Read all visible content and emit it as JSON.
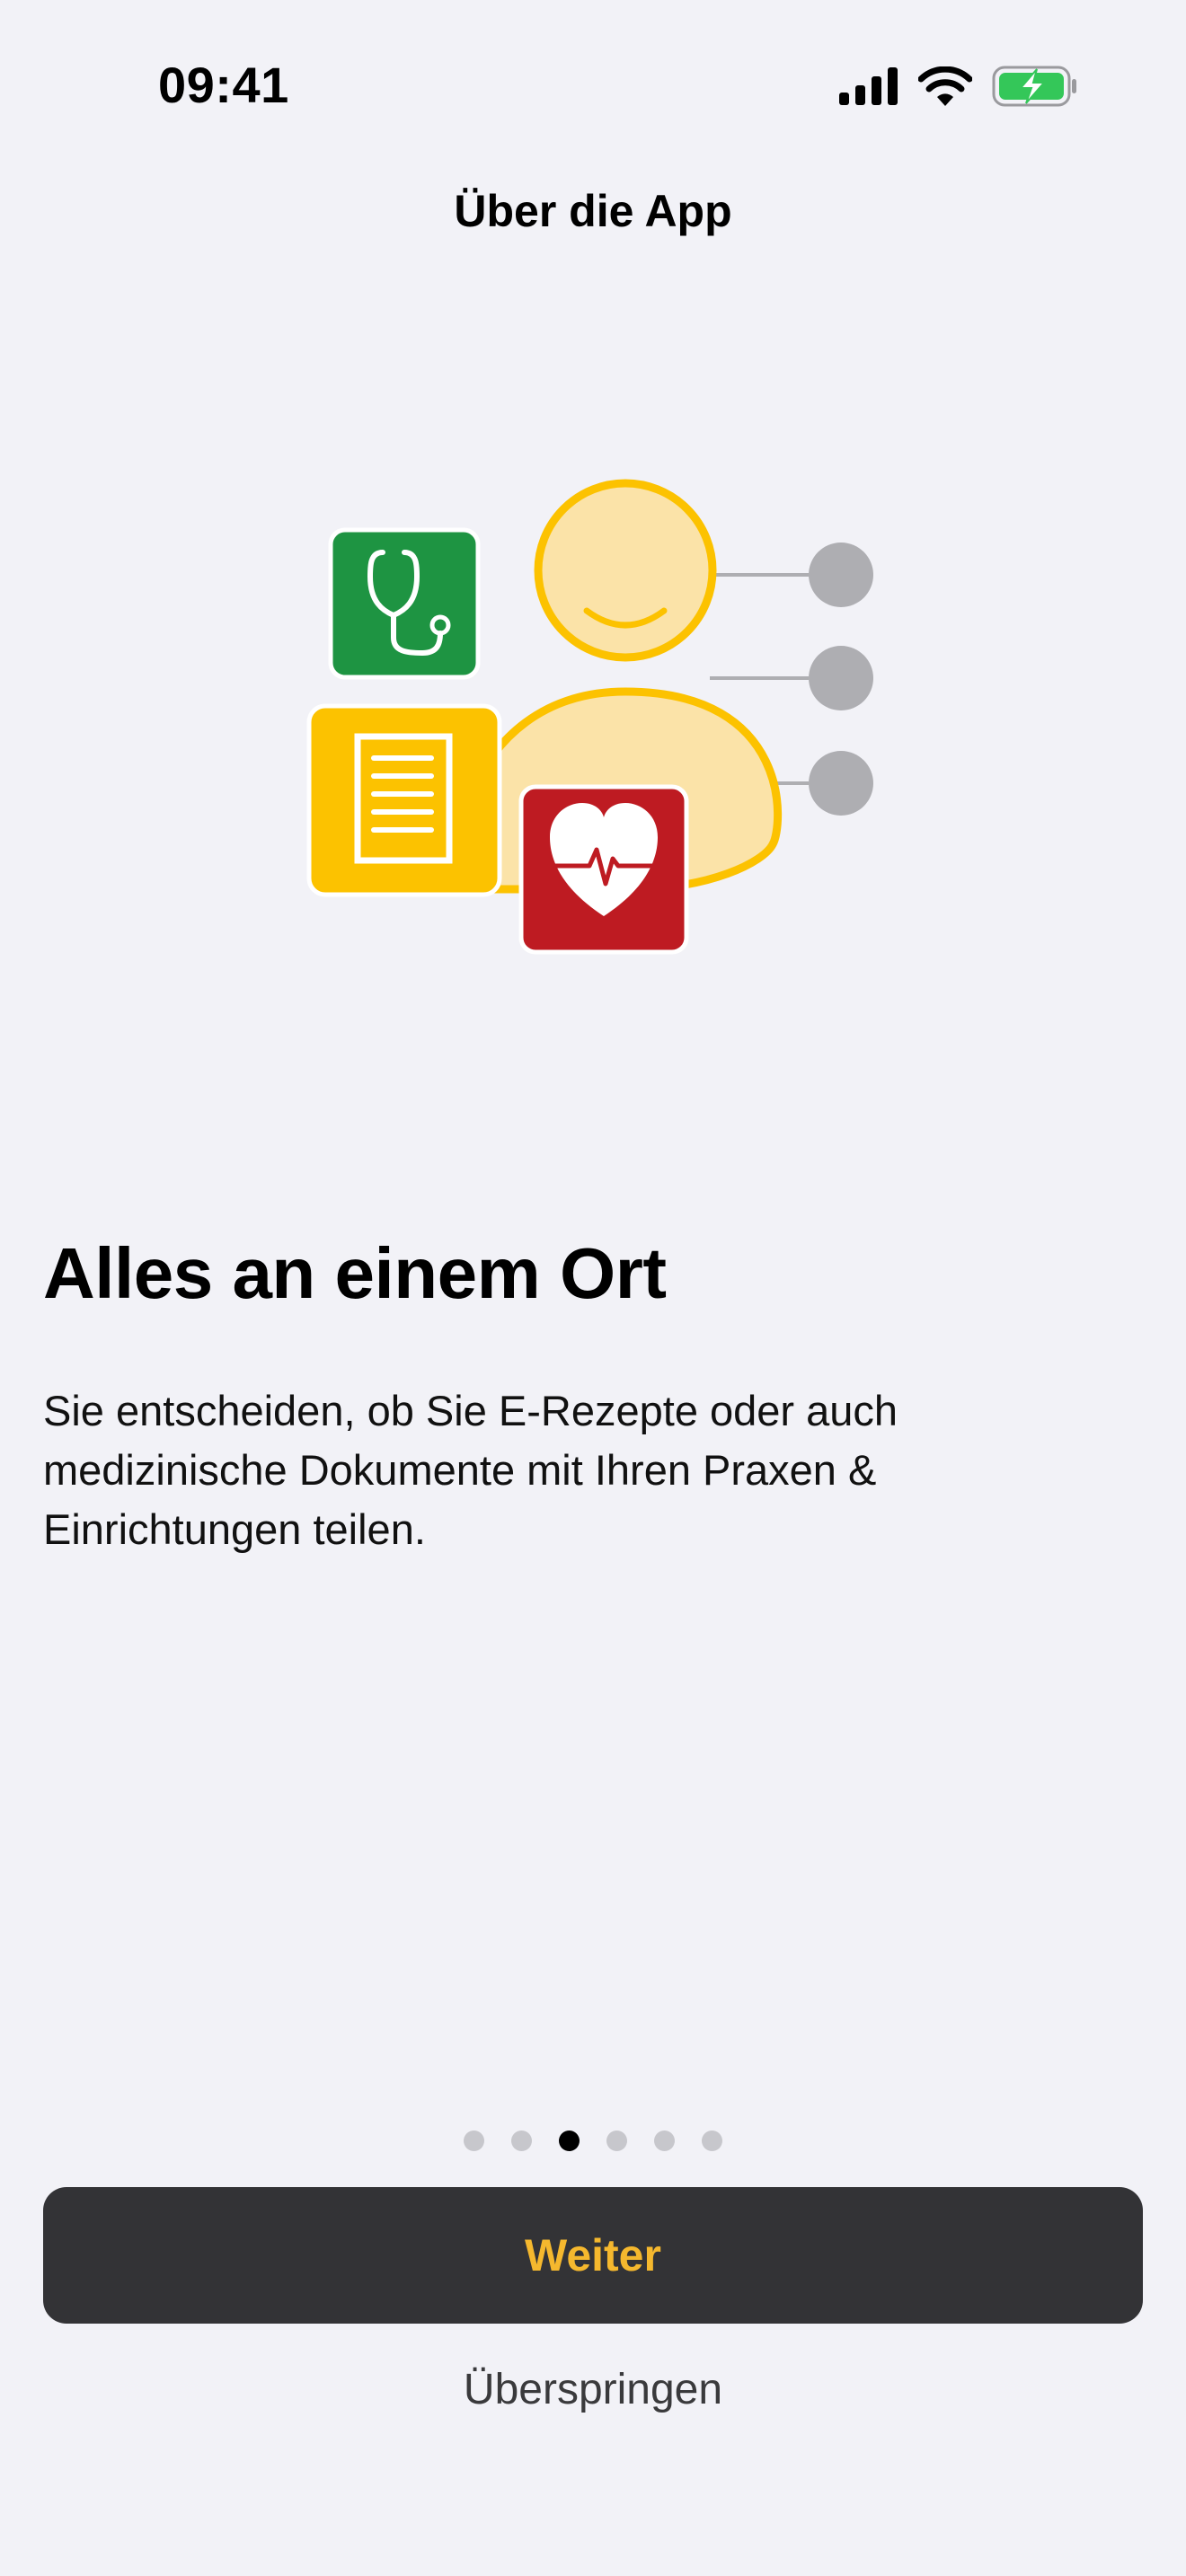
{
  "status_bar": {
    "time": "09:41",
    "icons": [
      "cellular-signal-icon",
      "wifi-icon",
      "battery-charging-icon"
    ]
  },
  "nav": {
    "title": "Über die App"
  },
  "hero": {
    "illustration": [
      "person-icon",
      "stethoscope-icon",
      "document-icon",
      "heart-rate-icon"
    ],
    "colors": {
      "person_fill": "#FBE3A8",
      "person_stroke": "#FCC200",
      "stethoscope_tile": "#1E9442",
      "document_tile": "#FCC200",
      "heart_tile": "#BE1B22",
      "connector": "#AEAEB2"
    }
  },
  "content": {
    "headline": "Alles an einem Ort",
    "body": "Sie entscheiden, ob Sie E-Rezepte oder auch medizinische Dokumente mit Ihren Praxen & Einrichtungen teilen."
  },
  "pager": {
    "total": 6,
    "current": 3
  },
  "actions": {
    "primary_label": "Weiter",
    "secondary_label": "Überspringen"
  },
  "colors": {
    "background": "#F2F2F7",
    "button_background": "#333336",
    "button_text": "#F5B82E",
    "battery_green": "#34C759"
  }
}
